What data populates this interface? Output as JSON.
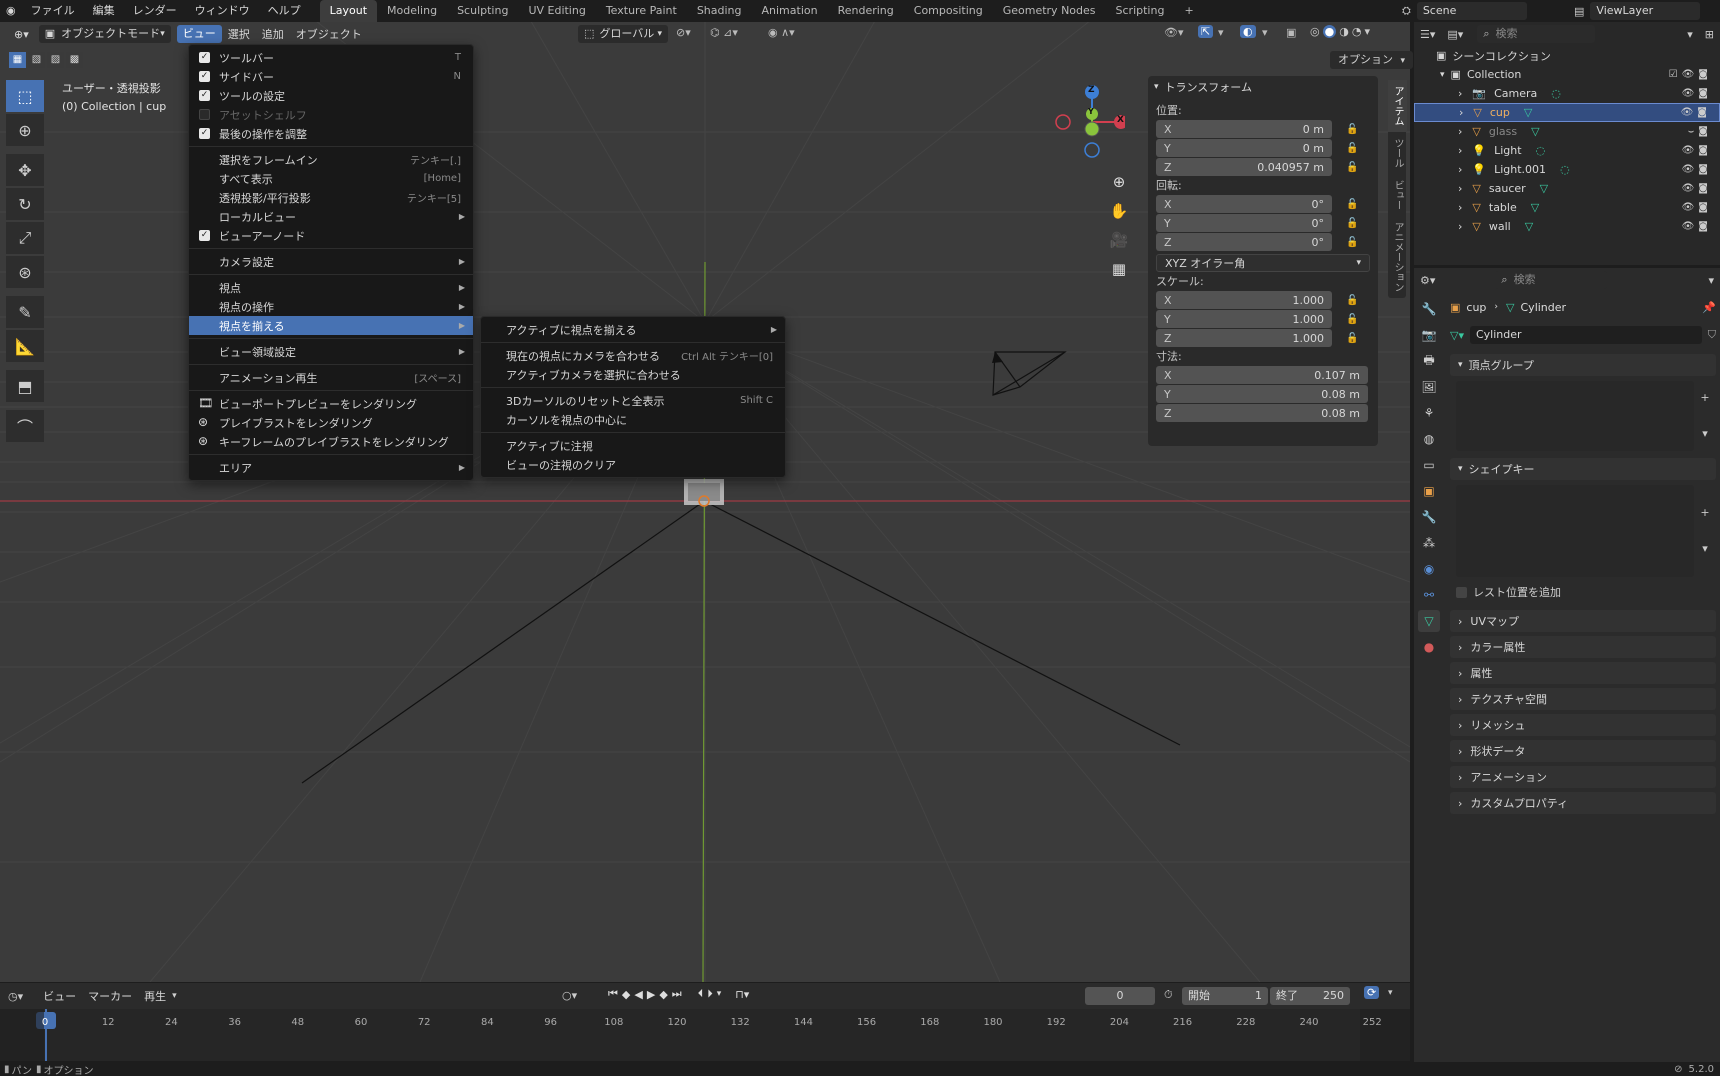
{
  "topbar": {
    "menus": [
      "ファイル",
      "編集",
      "レンダー",
      "ウィンドウ",
      "ヘルプ"
    ],
    "workspaces": [
      "Layout",
      "Modeling",
      "Sculpting",
      "UV Editing",
      "Texture Paint",
      "Shading",
      "Animation",
      "Rendering",
      "Compositing",
      "Geometry Nodes",
      "Scripting"
    ],
    "add_tab": "+",
    "scene": "Scene",
    "view_layer": "ViewLayer"
  },
  "viewport_header": {
    "mode": "オブジェクトモード",
    "menus": [
      "ビュー",
      "選択",
      "追加",
      "オブジェクト"
    ],
    "transform_orientation": "グローバル",
    "options": "オプション"
  },
  "viewport": {
    "view_name": "ユーザー・透視投影",
    "collection_info": "(0) Collection | cup",
    "gizmo": {
      "z": "Z",
      "y": "Y",
      "x": "X"
    }
  },
  "view_menu": {
    "items": [
      {
        "label": "ツールバー",
        "shortcut": "T",
        "check": "on"
      },
      {
        "label": "サイドバー",
        "shortcut": "N",
        "check": "on"
      },
      {
        "label": "ツールの設定",
        "check": "on"
      },
      {
        "label": "アセットシェルフ",
        "check": "off",
        "disabled": true
      },
      {
        "label": "最後の操作を調整",
        "check": "on"
      },
      {
        "sep": true
      },
      {
        "label": "選択をフレームイン",
        "shortcut": "テンキー[.]"
      },
      {
        "label": "すべて表示",
        "shortcut": "[Home]"
      },
      {
        "label": "透視投影/平行投影",
        "shortcut": "テンキー[5]"
      },
      {
        "label": "ローカルビュー",
        "submenu": true
      },
      {
        "label": "ビューアーノード",
        "check": "on"
      },
      {
        "sep": true
      },
      {
        "label": "カメラ設定",
        "submenu": true
      },
      {
        "sep": true
      },
      {
        "label": "視点",
        "submenu": true
      },
      {
        "label": "視点の操作",
        "submenu": true
      },
      {
        "label": "視点を揃える",
        "submenu": true,
        "highlight": true
      },
      {
        "sep": true
      },
      {
        "label": "ビュー領域設定",
        "submenu": true
      },
      {
        "sep": true
      },
      {
        "label": "アニメーション再生",
        "shortcut": "[スペース]"
      },
      {
        "sep": true
      },
      {
        "label": "ビューポートプレビューをレンダリング",
        "icon": "render-icon"
      },
      {
        "label": "プレイブラストをレンダリング",
        "icon": "reel-icon"
      },
      {
        "label": "キーフレームのプレイブラストをレンダリング",
        "icon": "reel-icon"
      },
      {
        "sep": true
      },
      {
        "label": "エリア",
        "submenu": true
      }
    ]
  },
  "align_submenu": {
    "items": [
      {
        "label": "アクティブに視点を揃える",
        "submenu": true
      },
      {
        "sep": true
      },
      {
        "label": "現在の視点にカメラを合わせる",
        "shortcut": "Ctrl Alt テンキー[0]"
      },
      {
        "label": "アクティブカメラを選択に合わせる"
      },
      {
        "sep": true
      },
      {
        "label": "3Dカーソルのリセットと全表示",
        "shortcut": "Shift C"
      },
      {
        "label": "カーソルを視点の中心に"
      },
      {
        "sep": true
      },
      {
        "label": "アクティブに注視"
      },
      {
        "label": "ビューの注視のクリア"
      }
    ]
  },
  "npanel": {
    "header": "トランスフォーム",
    "location_label": "位置:",
    "location": [
      {
        "axis": "X",
        "value": "0 m"
      },
      {
        "axis": "Y",
        "value": "0 m"
      },
      {
        "axis": "Z",
        "value": "0.040957 m"
      }
    ],
    "rotation_label": "回転:",
    "rotation": [
      {
        "axis": "X",
        "value": "0°"
      },
      {
        "axis": "Y",
        "value": "0°"
      },
      {
        "axis": "Z",
        "value": "0°"
      }
    ],
    "rotation_mode": "XYZ オイラー角",
    "scale_label": "スケール:",
    "scale": [
      {
        "axis": "X",
        "value": "1.000"
      },
      {
        "axis": "Y",
        "value": "1.000"
      },
      {
        "axis": "Z",
        "value": "1.000"
      }
    ],
    "dimensions_label": "寸法:",
    "dimensions": [
      {
        "axis": "X",
        "value": "0.107 m"
      },
      {
        "axis": "Y",
        "value": "0.08 m"
      },
      {
        "axis": "Z",
        "value": "0.08 m"
      }
    ],
    "tabs": [
      "アイテム",
      "ツール",
      "ビュー",
      "アニメーション"
    ]
  },
  "outliner": {
    "search_placeholder": "検索",
    "root": "シーンコレクション",
    "collection": "Collection",
    "items": [
      {
        "name": "Camera",
        "icon": "camera-icon",
        "color": "#e8a04a",
        "selected": false
      },
      {
        "name": "cup",
        "icon": "mesh-icon",
        "color": "#e8a04a",
        "selected": true
      },
      {
        "name": "glass",
        "icon": "mesh-icon",
        "color": "#e8a04a",
        "selected": false,
        "dim": true
      },
      {
        "name": "Light",
        "icon": "light-icon",
        "color": "#e8a04a",
        "selected": false
      },
      {
        "name": "Light.001",
        "icon": "light-icon",
        "color": "#e8a04a",
        "selected": false
      },
      {
        "name": "saucer",
        "icon": "mesh-icon",
        "color": "#e8a04a",
        "selected": false
      },
      {
        "name": "table",
        "icon": "mesh-icon",
        "color": "#e8a04a",
        "selected": false
      },
      {
        "name": "wall",
        "icon": "mesh-icon",
        "color": "#e8a04a",
        "selected": false
      }
    ]
  },
  "properties": {
    "search_placeholder": "検索",
    "breadcrumb_object": "cup",
    "breadcrumb_data": "Cylinder",
    "datablock_name": "Cylinder",
    "vertex_groups": "頂点グループ",
    "shape_keys": "シェイプキー",
    "rest_position": "レスト位置を追加",
    "panels": [
      "UVマップ",
      "カラー属性",
      "属性",
      "テクスチャ空間",
      "リメッシュ",
      "形状データ",
      "アニメーション",
      "カスタムプロパティ"
    ]
  },
  "timeline": {
    "menus": [
      "ビュー",
      "マーカー",
      "再生"
    ],
    "current_frame": "0",
    "start_label": "開始",
    "start": "1",
    "end_label": "終了",
    "end": "250",
    "ticks": [
      "0",
      "12",
      "24",
      "36",
      "48",
      "60",
      "72",
      "84",
      "96",
      "108",
      "120",
      "132",
      "144",
      "156",
      "168",
      "180",
      "192",
      "204",
      "216",
      "228",
      "240",
      "252"
    ]
  },
  "status": {
    "left1": "パン",
    "left2": "オプション",
    "version": "5.2.0"
  },
  "colors": {
    "accent": "#4772b3",
    "x_axis": "#d23f4f",
    "y_axis": "#8ac43c",
    "z_axis": "#3d7fd6",
    "object": "#e8a04a",
    "mesh_data": "#3ac9a0"
  }
}
